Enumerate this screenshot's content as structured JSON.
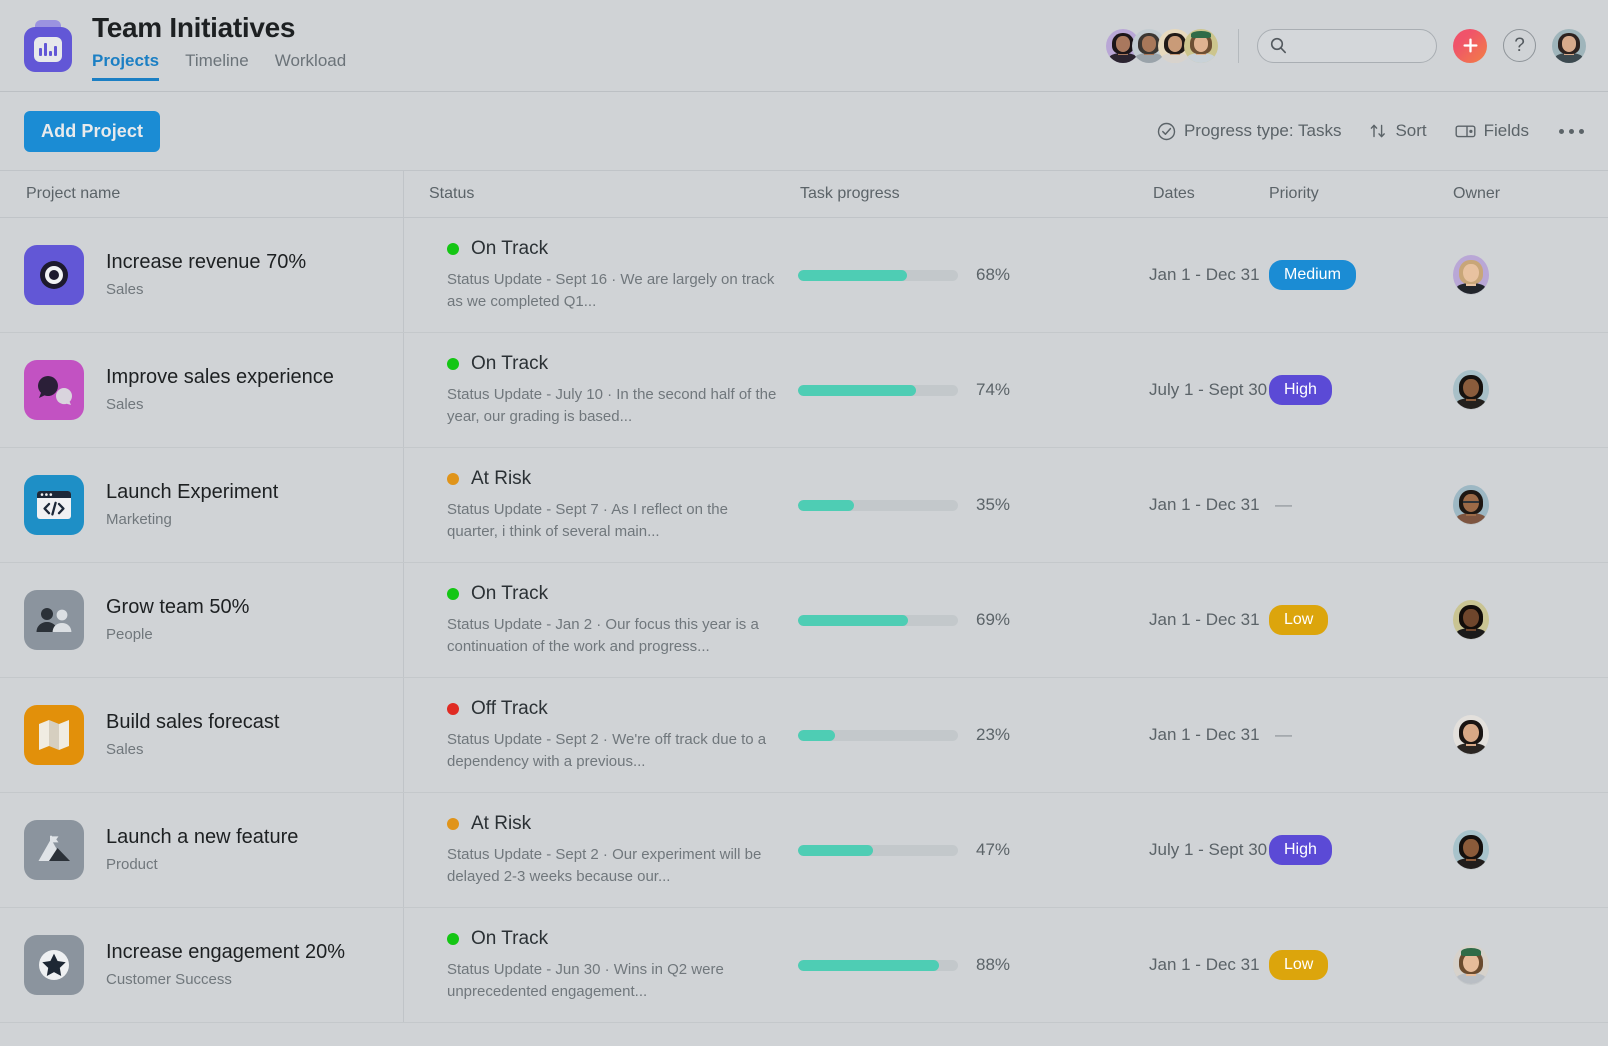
{
  "header": {
    "app_icon": "bar-chart-app-icon",
    "title": "Team Initiatives",
    "tabs": [
      {
        "label": "Projects",
        "active": true
      },
      {
        "label": "Timeline",
        "active": false
      },
      {
        "label": "Workload",
        "active": false
      }
    ],
    "member_avatars": [
      {
        "name": "member-avatar-1",
        "ring": "#b9a7d6",
        "hair": "#1b1518",
        "skin": "#a9785e",
        "body": "#2b2430",
        "hat": ""
      },
      {
        "name": "member-avatar-2",
        "ring": "#c3ccd1",
        "hair": "#3b3733",
        "skin": "#a8785a",
        "body": "#9aa3aa",
        "hat": ""
      },
      {
        "name": "member-avatar-3",
        "ring": "#e7d9bd",
        "hair": "#211a17",
        "skin": "#c99b78",
        "body": "#d8d3cd",
        "hat": ""
      },
      {
        "name": "member-avatar-4",
        "ring": "#ccc58d",
        "hair": "#6e5034",
        "skin": "#e0b391",
        "body": "#c9d2d8",
        "hat": "#2f6b47"
      }
    ],
    "search": {
      "value": "",
      "placeholder": "",
      "icon": "search-icon"
    },
    "add_button": {
      "icon": "plus-icon",
      "color": "#f0536a"
    },
    "help_button": {
      "label": "?"
    },
    "me_avatar": {
      "ring": "#9fb5bb",
      "hair": "#2e2320",
      "skin": "#d8ab8c",
      "body": "#3d4a50"
    }
  },
  "toolbar": {
    "add_project_label": "Add Project",
    "progress_type": {
      "label": "Progress type: Tasks",
      "icon": "check-circle-icon"
    },
    "sort": {
      "label": "Sort",
      "icon": "sort-arrows-icon"
    },
    "fields": {
      "label": "Fields",
      "icon": "fields-panel-icon"
    },
    "overflow": {
      "icon": "more-horizontal-icon"
    }
  },
  "table": {
    "columns": [
      "Project name",
      "Status",
      "Task progress",
      "Dates",
      "Priority",
      "Owner"
    ],
    "rows": [
      {
        "name": "Increase revenue 70%",
        "team": "Sales",
        "icon": {
          "glyph": "target-icon",
          "bg": "#6257d6"
        },
        "status": {
          "label": "On Track",
          "color": "#14c614"
        },
        "update": "Status Update - Sept 16 · We are largely on track as we completed Q1...",
        "progress": 68,
        "progress_label": "68%",
        "dates": "Jan 1 - Dec 31",
        "priority": {
          "label": "Medium",
          "color": "#1b8cd4"
        },
        "owner": {
          "ring": "#b9a7d6",
          "hair": "#c8a678",
          "skin": "#e8c2a0",
          "body": "#22252b"
        }
      },
      {
        "name": "Improve sales experience",
        "team": "Sales",
        "icon": {
          "glyph": "speech-bubbles-icon",
          "bg": "#c252c2"
        },
        "status": {
          "label": "On Track",
          "color": "#14c614"
        },
        "update": "Status Update - July 10 · In the second half of the year, our grading is based...",
        "progress": 74,
        "progress_label": "74%",
        "dates": "July 1 - Sept 30",
        "priority": {
          "label": "High",
          "color": "#5b4ad6"
        },
        "owner": {
          "ring": "#a8c0c8",
          "hair": "#16120f",
          "skin": "#8a5c3c",
          "body": "#23201d"
        }
      },
      {
        "name": "Launch Experiment",
        "team": "Marketing",
        "icon": {
          "glyph": "code-window-icon",
          "bg": "#1e8fc6"
        },
        "status": {
          "label": "At Risk",
          "color": "#e0941a"
        },
        "update": "Status Update - Sept 7 · As I reflect on the quarter, i think of several main...",
        "progress": 35,
        "progress_label": "35%",
        "dates": "Jan 1 - Dec 31",
        "priority": {
          "label": "—",
          "color": ""
        },
        "owner": {
          "ring": "#9db8c4",
          "hair": "#1d1713",
          "skin": "#9c6a47",
          "body": "#7e5540",
          "glasses": true
        }
      },
      {
        "name": "Grow team 50%",
        "team": "People",
        "icon": {
          "glyph": "people-icon",
          "bg": "#8b949e"
        },
        "status": {
          "label": "On Track",
          "color": "#14c614"
        },
        "update": "Status Update - Jan 2 · Our focus this year is a continuation of the work and progress...",
        "progress": 69,
        "progress_label": "69%",
        "dates": "Jan 1 - Dec 31",
        "priority": {
          "label": "Low",
          "color": "#dca50c"
        },
        "owner": {
          "ring": "#c9c493",
          "hair": "#120d0a",
          "skin": "#6f462c",
          "body": "#1b1a1a"
        }
      },
      {
        "name": "Build sales forecast",
        "team": "Sales",
        "icon": {
          "glyph": "map-icon",
          "bg": "#e2900a"
        },
        "status": {
          "label": "Off Track",
          "color": "#e02b23"
        },
        "update": "Status Update - Sept 2 · We're off track due to a dependency with a previous...",
        "progress": 23,
        "progress_label": "23%",
        "dates": "Jan 1 - Dec 31",
        "priority": {
          "label": "—",
          "color": ""
        },
        "owner": {
          "ring": "#e3e0dc",
          "hair": "#1a1412",
          "skin": "#d8a886",
          "body": "#2a2522"
        }
      },
      {
        "name": "Launch a new feature",
        "team": "Product",
        "icon": {
          "glyph": "mountain-flag-icon",
          "bg": "#8b949e"
        },
        "status": {
          "label": "At Risk",
          "color": "#e0941a"
        },
        "update": "Status Update - Sept 2 · Our experiment will be delayed 2-3 weeks because our...",
        "progress": 47,
        "progress_label": "47%",
        "dates": "July 1 - Sept 30",
        "priority": {
          "label": "High",
          "color": "#5b4ad6"
        },
        "owner": {
          "ring": "#a8c3cb",
          "hair": "#14100e",
          "skin": "#8b5b3a",
          "body": "#211d1b"
        }
      },
      {
        "name": "Increase engagement 20%",
        "team": "Customer Success",
        "icon": {
          "glyph": "star-icon",
          "bg": "#8b949e"
        },
        "status": {
          "label": "On Track",
          "color": "#14c614"
        },
        "update": "Status Update - Jun 30 · Wins in Q2 were unprecedented engagement...",
        "progress": 88,
        "progress_label": "88%",
        "dates": "Jan 1 - Dec 31",
        "priority": {
          "label": "Low",
          "color": "#dca50c"
        },
        "owner": {
          "ring": "#d7d2cb",
          "hair": "#6b4b2e",
          "skin": "#e6bb99",
          "body": "#b9bec4",
          "hat": "#2f6b47"
        }
      }
    ]
  }
}
